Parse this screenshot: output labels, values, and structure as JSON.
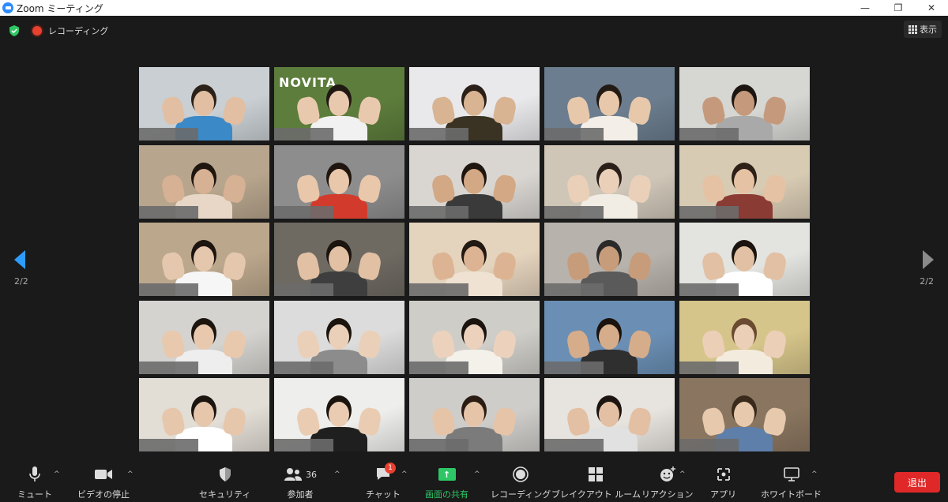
{
  "window": {
    "title": "Zoom ミーティング",
    "minimize": "—",
    "restore": "❐",
    "close": "✕"
  },
  "status": {
    "recording_label": "レコーディング",
    "view_label": "表示"
  },
  "gallery": {
    "page_left": "2/2",
    "page_right": "2/2",
    "tiles": [
      {
        "bg": "#c9cfd3",
        "body": "#3b89c6",
        "head": "#e2bfa2",
        "hair": "#2b2119"
      },
      {
        "bg": "#5d7d3c",
        "body": "#f1f1f1",
        "head": "#e9c9ad",
        "hair": "#201813",
        "logo": "NOVITA"
      },
      {
        "bg": "#e9e9ec",
        "body": "#3a3222",
        "head": "#d8b493",
        "hair": "#2a2018"
      },
      {
        "bg": "#6b7d8e",
        "body": "#f3eee8",
        "head": "#e7c8ab",
        "hair": "#231a14"
      },
      {
        "bg": "#d6d6d3",
        "body": "#a9a9a9",
        "head": "#c59a7c",
        "hair": "#1c1510"
      },
      {
        "bg": "#b7a58d",
        "body": "#e8d7c6",
        "head": "#d7b194",
        "hair": "#1f1610"
      },
      {
        "bg": "#8d8d8d",
        "body": "#d23b2b",
        "head": "#e9c7ab",
        "hair": "#201610"
      },
      {
        "bg": "#d9d6d2",
        "body": "#3a3a3a",
        "head": "#d3a884",
        "hair": "#1e150f"
      },
      {
        "bg": "#cfc6b8",
        "body": "#f1ece4",
        "head": "#ead0b8",
        "hair": "#2a2019"
      },
      {
        "bg": "#d8cbb4",
        "body": "#8a3b33",
        "head": "#e5c2a4",
        "hair": "#2c2017"
      },
      {
        "bg": "#bba78c",
        "body": "#f6f6f6",
        "head": "#e5c7ad",
        "hair": "#1c140e"
      },
      {
        "bg": "#6e6a62",
        "body": "#3e3e3e",
        "head": "#e2c0a4",
        "hair": "#1b140f"
      },
      {
        "bg": "#e4d3bd",
        "body": "#efe2d2",
        "head": "#dcb493",
        "hair": "#221912"
      },
      {
        "bg": "#b7b2ab",
        "body": "#5a5a5a",
        "head": "#c79c7b",
        "hair": "#2a2a2a"
      },
      {
        "bg": "#e3e3e0",
        "body": "#ffffff",
        "head": "#e2c0a3",
        "hair": "#1a130e"
      },
      {
        "bg": "#d4d3cf",
        "body": "#eeeeee",
        "head": "#e8c9ae",
        "hair": "#1c140e"
      },
      {
        "bg": "#dcdcdc",
        "body": "#8c8c8c",
        "head": "#ebd0b9",
        "hair": "#1a130e"
      },
      {
        "bg": "#cfcdc8",
        "body": "#f4f0ea",
        "head": "#ecd2bd",
        "hair": "#1a130e"
      },
      {
        "bg": "#6b8fb4",
        "body": "#2f2f2f",
        "head": "#d6ad8b",
        "hair": "#1a130e"
      },
      {
        "bg": "#d6c58a",
        "body": "#f3ecde",
        "head": "#ebcfb6",
        "hair": "#6a4a30"
      },
      {
        "bg": "#e2ddd5",
        "body": "#ffffff",
        "head": "#e6c7ab",
        "hair": "#1c140e"
      },
      {
        "bg": "#eeeeec",
        "body": "#1f1f1f",
        "head": "#e9ccb2",
        "hair": "#1a130e"
      },
      {
        "bg": "#cfcdca",
        "body": "#7b7b7b",
        "head": "#e6c4a8",
        "hair": "#2a1c12"
      },
      {
        "bg": "#e7e4df",
        "body": "#e1e1e1",
        "head": "#e3c0a3",
        "hair": "#1c140e"
      },
      {
        "bg": "#8a7660",
        "body": "#5d7fa9",
        "head": "#e7c9ad",
        "hair": "#3a2a1c"
      }
    ]
  },
  "toolbar": {
    "mute": "ミュート",
    "video": "ビデオの停止",
    "security": "セキュリティ",
    "participants": "参加者",
    "participants_count": "36",
    "chat": "チャット",
    "chat_badge": "1",
    "share": "画面の共有",
    "share_icon": "↑",
    "record": "レコーディング",
    "breakout": "ブレイクアウト ルーム",
    "reactions": "リアクション",
    "apps": "アプリ",
    "whiteboard": "ホワイトボード",
    "leave": "退出",
    "accent_green": "#2ec765",
    "leave_red": "#e02828"
  }
}
